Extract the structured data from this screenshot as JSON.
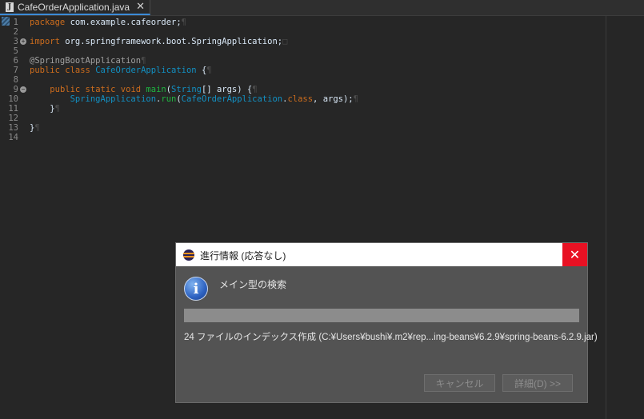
{
  "tab": {
    "title": "CafeOrderApplication.java",
    "file_icon_letter": "J"
  },
  "editor": {
    "lines": [
      {
        "n": "1",
        "fold": "",
        "tokens": [
          {
            "t": "package",
            "c": "kw"
          },
          {
            "t": " com.example.cafeorder;",
            "c": ""
          },
          {
            "t": "¶",
            "c": "ws"
          }
        ]
      },
      {
        "n": "2",
        "fold": "",
        "tokens": []
      },
      {
        "n": "3",
        "fold": "+",
        "tokens": [
          {
            "t": "import",
            "c": "kw"
          },
          {
            "t": " org.springframework.boot.SpringApplication;",
            "c": ""
          },
          {
            "t": "□",
            "c": "ws"
          }
        ]
      },
      {
        "n": "5",
        "fold": "",
        "tokens": []
      },
      {
        "n": "6",
        "fold": "",
        "tokens": [
          {
            "t": "@SpringBootApplication",
            "c": "ann"
          },
          {
            "t": "¶",
            "c": "ws"
          }
        ]
      },
      {
        "n": "7",
        "fold": "",
        "tokens": [
          {
            "t": "public class",
            "c": "kw"
          },
          {
            "t": " ",
            "c": ""
          },
          {
            "t": "CafeOrderApplication",
            "c": "cls"
          },
          {
            "t": " {",
            "c": ""
          },
          {
            "t": "¶",
            "c": "ws"
          }
        ]
      },
      {
        "n": "8",
        "fold": "",
        "tokens": []
      },
      {
        "n": "9",
        "fold": "−",
        "tokens": [
          {
            "t": "    ",
            "c": ""
          },
          {
            "t": "public static void",
            "c": "kw"
          },
          {
            "t": " ",
            "c": ""
          },
          {
            "t": "main",
            "c": "mth"
          },
          {
            "t": "(",
            "c": ""
          },
          {
            "t": "String",
            "c": "cls"
          },
          {
            "t": "[] args) {",
            "c": ""
          },
          {
            "t": "¶",
            "c": "ws"
          }
        ]
      },
      {
        "n": "10",
        "fold": "",
        "tokens": [
          {
            "t": "        ",
            "c": ""
          },
          {
            "t": "SpringApplication",
            "c": "cls"
          },
          {
            "t": ".",
            "c": ""
          },
          {
            "t": "run",
            "c": "mth"
          },
          {
            "t": "(",
            "c": ""
          },
          {
            "t": "CafeOrderApplication",
            "c": "cls"
          },
          {
            "t": ".",
            "c": ""
          },
          {
            "t": "class",
            "c": "kw"
          },
          {
            "t": ", args);",
            "c": ""
          },
          {
            "t": "¶",
            "c": "ws"
          }
        ]
      },
      {
        "n": "11",
        "fold": "",
        "tokens": [
          {
            "t": "    }",
            "c": ""
          },
          {
            "t": "¶",
            "c": "ws"
          }
        ]
      },
      {
        "n": "12",
        "fold": "",
        "tokens": []
      },
      {
        "n": "13",
        "fold": "",
        "tokens": [
          {
            "t": "}",
            "c": ""
          },
          {
            "t": "¶",
            "c": "ws"
          }
        ]
      },
      {
        "n": "14",
        "fold": "",
        "tokens": []
      }
    ]
  },
  "dialog": {
    "title": "進行情報 (応答なし)",
    "close_glyph": "✕",
    "info_glyph": "i",
    "task_name": "メイン型の検索",
    "progress": 1.0,
    "sub_task": "24 ファイルのインデックス作成 (C:¥Users¥bushi¥.m2¥rep...ing-beans¥6.2.9¥spring-beans-6.2.9.jar)",
    "cancel_label": "キャンセル",
    "details_label": "詳細(D) >>"
  },
  "colors": {
    "keyword": "#cc6c1d",
    "class": "#1290c3",
    "method": "#1eb540",
    "close_red": "#e81123"
  }
}
